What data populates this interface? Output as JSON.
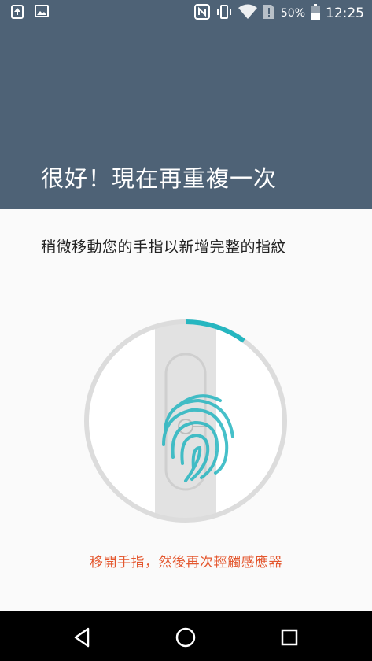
{
  "status_bar": {
    "battery": "50%",
    "time": "12:25",
    "left_icons": [
      "upload-icon",
      "image-icon"
    ],
    "right_icons": [
      "nfc-icon",
      "vibrate-icon",
      "wifi-icon",
      "sim-alert-icon",
      "battery-icon"
    ]
  },
  "header": {
    "title": "很好！現在再重複一次"
  },
  "main": {
    "instruction": "稍微移動您的手指以新增完整的指紋",
    "status_message": "移開手指，然後再次輕觸感應器",
    "progress": 0.1
  },
  "nav": {
    "icons": [
      "back-icon",
      "home-icon",
      "recents-icon"
    ]
  },
  "colors": {
    "header_bg": "#4e6276",
    "accent": "#26b6c0",
    "status_message": "#e4572e"
  }
}
